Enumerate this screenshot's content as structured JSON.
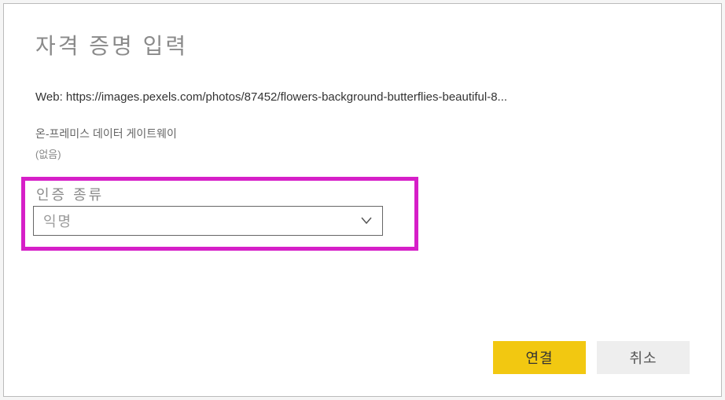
{
  "dialog": {
    "title": "자격 증명 입력",
    "url_line": "Web: https://images.pexels.com/photos/87452/flowers-background-butterflies-beautiful-8...",
    "gateway_label": "온-프레미스 데이터 게이트웨이",
    "gateway_value": "(없음)",
    "auth": {
      "label": "인증 종류",
      "selected": "익명"
    },
    "buttons": {
      "connect": "연결",
      "cancel": "취소"
    }
  }
}
